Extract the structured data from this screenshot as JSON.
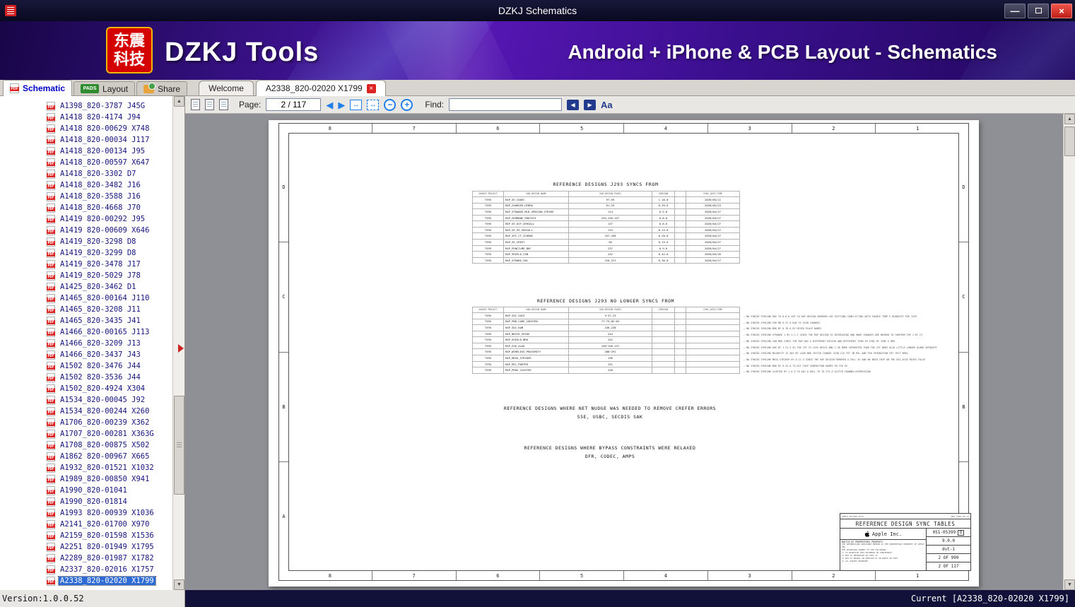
{
  "titlebar": {
    "title": "DZKJ Schematics",
    "minimize_glyph": "—",
    "close_glyph": "×"
  },
  "banner": {
    "logo_top": "东震",
    "logo_bottom": "科技",
    "brand": "DZKJ Tools",
    "headline": "Android + iPhone & PCB Layout - Schematics"
  },
  "tabs": {
    "schematic": "Schematic",
    "layout": "Layout",
    "share": "Share",
    "pdf_icon_text": "PDF",
    "layout_icon_text": "PADS",
    "welcome": "Welcome",
    "document": "A2338_820-02020 X1799",
    "close_glyph": "×"
  },
  "toolbar": {
    "page_label": "Page:",
    "page_value": "2 / 117",
    "find_label": "Find:",
    "find_value": "",
    "prev_glyph": "◀",
    "next_glyph": "▶",
    "fit_width_glyph": "↔",
    "fit_page_glyph": "↔",
    "zoom_out_glyph": "−",
    "zoom_in_glyph": "+",
    "find_prev_glyph": "◀",
    "find_next_glyph": "▶",
    "match_case_glyph": "Aa"
  },
  "sidebar": {
    "selected_index": 42,
    "scroll_up_glyph": "▲",
    "scroll_down_glyph": "▼",
    "items": [
      "A1398_820-3787 J45G",
      "A1418 820-4174 J94",
      "A1418 820-00629 X748",
      "A1418_820-00034 J117",
      "A1418_820-00134 J95",
      "A1418_820-00597 X647",
      "A1418_820-3302 D7",
      "A1418_820-3482 J16",
      "A1418_820-3588 J16",
      "A1418_820-4668 J70",
      "A1419 820-00292 J95",
      "A1419 820-00609 X646",
      "A1419_820-3298 D8",
      "A1419_820-3299 D8",
      "A1419_820-3478 J17",
      "A1419_820-5029 J78",
      "A1425_820-3462 D1",
      "A1465_820-00164 J110",
      "A1465_820-3208 J11",
      "A1465_820-3435 J41",
      "A1466_820-00165 J113",
      "A1466_820-3209 J13",
      "A1466_820-3437 J43",
      "A1502 820-3476 J44",
      "A1502 820-3536 J44",
      "A1502_820-4924 X304",
      "A1534_820-00045 J92",
      "A1534_820-00244 X260",
      "A1706_820-00239 X362",
      "A1707_820-00281 X363G",
      "A1708_820-00875 X502",
      "A1862 820-00967 X665",
      "A1932_820-01521 X1032",
      "A1989_820-00850 X941",
      "A1990_820-01041",
      "A1990_820-01814",
      "A1993 820-00939 X1036",
      "A2141_820-01700 X970",
      "A2159_820-01598 X1536",
      "A2251 820-01949 X1795",
      "A2289_820-01987 X1782",
      "A2337_820-02016 X1757",
      "A2338_820-02020 X1799"
    ]
  },
  "pdf": {
    "grid_cols": [
      "8",
      "7",
      "6",
      "5",
      "4",
      "3",
      "2",
      "1"
    ],
    "grid_rows": [
      "D",
      "C",
      "B",
      "A"
    ],
    "table1_title": "REFERENCE DESIGNS J293 SYNCS FROM",
    "table2_title": "REFERENCE DESIGNS J293 NO LONGER SYNCS FROM",
    "table_headers": [
      "SOURCE PROJECT",
      "SUB-DESIGN NAME",
      "SUB-DESIGN PAGES",
      "VERSION",
      "",
      "SYNC_DATE/TIME"
    ],
    "table1_rows": [
      {
        "project": "T595",
        "name": "RAP_SE_CODEC",
        "pages": "97,59",
        "version": "1.18.0",
        "flag": "",
        "date": "2020/05/11"
      },
      {
        "project": "T595",
        "name": "RAP_CHARGER_HYDRA",
        "pages": "61,53",
        "version": "0.39.0",
        "flag": "",
        "date": "2020/05/23"
      },
      {
        "project": "T595",
        "name": "RAP_STRANGE_MLB_VERSION_STRIKE",
        "pages": "114",
        "version": "0.5.0",
        "flag": "",
        "date": "2020/04/27"
      },
      {
        "project": "T595",
        "name": "RAP_GERMANE_PROTO73",
        "pages": "244,246,247",
        "version": "0.8.0",
        "flag": "",
        "date": "2020/04/27"
      },
      {
        "project": "T595",
        "name": "RAP_SE_DIF_SERIALL",
        "pages": "137",
        "version": "0.8.0",
        "flag": "",
        "date": "2020/04/27"
      },
      {
        "project": "T595",
        "name": "RAP_SE_PS_SERIALL",
        "pages": "133",
        "version": "0.13.0",
        "flag": "",
        "date": "2020/04/27"
      },
      {
        "project": "T595",
        "name": "RAP_SPI_CT_SCREWS",
        "pages": "257,258",
        "version": "0.20.0",
        "flag": "",
        "date": "2020/04/27"
      },
      {
        "project": "T595",
        "name": "RAP_SE_CREST",
        "pages": "56",
        "version": "0.13.0",
        "flag": "",
        "date": "2020/04/27"
      },
      {
        "project": "T595",
        "name": "RAP_PENCILME_BUF",
        "pages": "237",
        "version": "0.9.0",
        "flag": "",
        "date": "2020/04/27"
      },
      {
        "project": "T595",
        "name": "RAP_SHIELD_CAN",
        "pages": "242",
        "version": "0.42.0",
        "flag": "",
        "date": "2020/04/26"
      },
      {
        "project": "T595",
        "name": "RAP_STROBE_CNL",
        "pages": "220,221",
        "version": "0.30.0",
        "flag": "",
        "date": "2020/04/27"
      }
    ],
    "table2_rows": [
      {
        "project": "T595",
        "name": "RAP_SOC_SOCS",
        "pages": "3~37,29",
        "version": "",
        "flag": "",
        "date": ""
      },
      {
        "project": "T595",
        "name": "RAP_PWR_CORE_CORSTEN",
        "pages": "77~79,82~83",
        "version": "",
        "flag": "",
        "date": ""
      },
      {
        "project": "T595",
        "name": "RAP_SOC_RAM",
        "pages": "236,238",
        "version": "",
        "flag": "",
        "date": ""
      },
      {
        "project": "T595",
        "name": "RAP_BRICK_SPIKE",
        "pages": "244",
        "version": "",
        "flag": "",
        "date": ""
      },
      {
        "project": "T595",
        "name": "RAP_SHIELD_BRK",
        "pages": "242",
        "version": "",
        "flag": "",
        "date": ""
      },
      {
        "project": "T595",
        "name": "RAP_CHG_ALGO",
        "pages": "150~156,157",
        "version": "",
        "flag": "",
        "date": ""
      },
      {
        "project": "T595",
        "name": "RAP_WIRELESS_PROXIMITY",
        "pages": "288~291",
        "version": "",
        "flag": "",
        "date": ""
      },
      {
        "project": "T595",
        "name": "RAP_MESA_STRIKER",
        "pages": "196",
        "version": "",
        "flag": "",
        "date": ""
      },
      {
        "project": "T595",
        "name": "RAP_MIC_PORTED",
        "pages": "251",
        "version": "",
        "flag": "",
        "date": ""
      },
      {
        "project": "T595",
        "name": "RAP_PROX_CLUSTER",
        "pages": "240",
        "version": "",
        "flag": "",
        "date": ""
      }
    ],
    "notes": [
      "NO SYNCED SYMLINK DUE TO 0.8.0 USE TO RAP DESIGN SHENZEN LED SECTIONS CONFLICTING WITH SOURCE TEMP'S READOUTS FOR J293",
      "NO SYNCED SYMLINK FOR BD 0.37.0 DUE TO SIGN CHANGES",
      "NO SYNCED SYMLINK BRK BY 0.78.0 BY MIXED PLACE NAMES",
      "NO SYNCED SYMLINK STRANGE 1 BY 1.1.1 SINCE THE RAP DESIGN IS DECREASING AND MANY CHANGES ARE NEEDED TO CONFIRM TOP 1 BY 21",
      "NO SYNCED SYMLINK CAN BRK SINCE THE RAP HAS A DIFFERENT DESIGN AND DIFFERENT TEAM IN SYNC BY SYNC'S BRK",
      "NO SYNCED SYMLINK DUE BY 1.51.3 AS THE CST IS LESS BRICK AND 1.56 MORE SEPARATED THAN THE CST BRKS ALSO LITTLE LONGER ALONG SEPARATE",
      "NO SYNCED SYMLINK MAJORITY IS ADJ BY LEAD BRK CRITIK CHANGE SIGN CLK TST IN MIL AND PIN SEPARATION CRT TEST BRKS",
      "NO SYNCED SYMLINK MESA STRIKER BY 0.11.5 SINCE THE RAP DESIGN REMOVED A FULL SE AND WE NEED CHIP ON THE DSG ALSO RESES FALSE",
      "NO SYNCED SYMLINK BRK BY 0.25.0 TO DIF CHIP GENERATION NAMES IN CIR SE",
      "NO SYNCED SYMLINK CLUSTER BY 1.0.5 TO ADJ A ROLL CH TO FIX A GLITCH CHANNEL/EXPRESSION"
    ],
    "block1_line1": "REFERENCE DESIGNS WHERE NET NUDGE WAS NEEDED TO REMOVE CREFER ERRORS",
    "block1_line2": "S5E, USBC, SECDIS SAK",
    "block2_line1": "REFERENCE DESIGNS WHERE BYPASS CONSTRAINTS WERE RELAXED",
    "block2_line2": "DFR, CODEC, AMPS",
    "title_block": {
      "strip_left": "APPLE 851786-T544",
      "strip_right": "REV 2020-05-11",
      "title": "REFERENCE DESIGN SYNC TABLES",
      "company": "Apple Inc.",
      "drawing_number": "051-05399",
      "size": "D",
      "version": "9.0.0",
      "stage": "dvt-1",
      "sheet_a": "2 OF 999",
      "sheet_b": "2 OF 117",
      "notice_title": "NOTICE OF PROPRIETARY PROPERTY:",
      "notice_lines": [
        "THE INFORMATION CONTAINED HEREIN IS THE PROPRIETARY PROPERTY OF APPLE INC.",
        "THE POSSESSOR AGREES TO THE FOLLOWING:",
        "1) TO MAINTAIN THIS DOCUMENT IN CONFIDENCE",
        "2) NOT TO REPRODUCE OR COPY IT",
        "3) NOT TO REVEAL OR PUBLISH IT IN WHOLE OR PART",
        "4) ALL RIGHTS RESERVED"
      ]
    }
  },
  "statusbar": {
    "version": "Version:1.0.0.52",
    "current": "Current [A2338_820-02020 X1799]"
  },
  "colors": {
    "accent_blue": "#1f7fe8",
    "brand_red": "#d40000",
    "banner_purple": "#5516b2",
    "selection_blue": "#2e6bd4"
  }
}
